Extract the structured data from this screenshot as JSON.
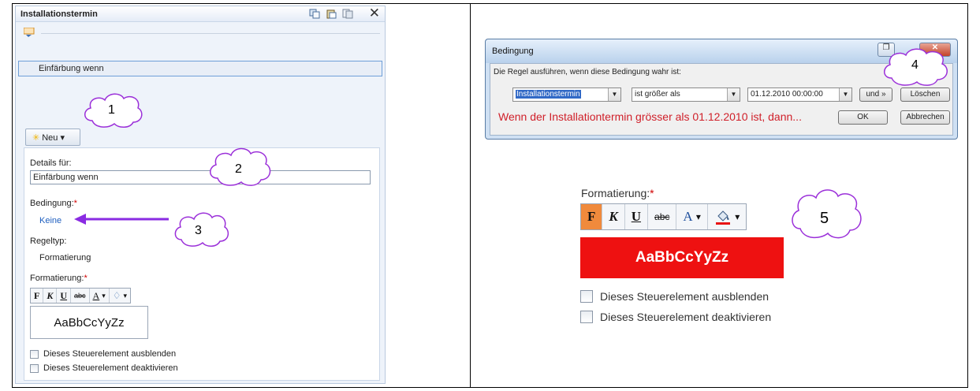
{
  "left_panel": {
    "title": "Installationstermin",
    "rule_item": "Einfärbung wenn",
    "new_button": "Neu",
    "details_label": "Details für:",
    "details_value": "Einfärbung wenn",
    "condition_label": "Bedingung:",
    "required_mark": "*",
    "condition_link": "Keine",
    "ruletype_label": "Regeltyp:",
    "ruletype_value": "Formatierung",
    "format_label": "Formatierung:",
    "toolbar": {
      "bold": "F",
      "italic": "K",
      "underline": "U",
      "strike": "abc",
      "font_color": "A"
    },
    "preview_text": "AaBbCcYyZz",
    "checkbox_hide": "Dieses Steuerelement ausblenden",
    "checkbox_disable": "Dieses Steuerelement deaktivieren"
  },
  "callouts": [
    "1",
    "2",
    "3",
    "4",
    "5"
  ],
  "dialog": {
    "title": "Bedingung",
    "prompt": "Die Regel ausführen, wenn diese Bedingung wahr ist:",
    "field_select": "Installationstermin",
    "operator_select": "ist größer als",
    "value_input": "01.12.2010 00:00:00",
    "and_button": "und »",
    "delete_button": "Löschen",
    "condition_text": "Wenn der Installationtermin grösser als 01.12.2010 ist, dann...",
    "ok_button": "OK",
    "cancel_button": "Abbrechen"
  },
  "zoomed_format": {
    "label": "Formatierung:",
    "required_mark": "*",
    "toolbar": {
      "bold": "F",
      "italic": "K",
      "underline": "U",
      "strike": "abc",
      "font_color": "A"
    },
    "preview_text": "AaBbCcYyZz",
    "checkbox_hide": "Dieses Steuerelement ausblenden",
    "checkbox_disable": "Dieses Steuerelement deaktivieren"
  },
  "colors": {
    "highlight_red": "#ee1111",
    "active_orange": "#f08a3c",
    "arrow_purple": "#8a2be2",
    "cloud_purple": "#9b30d9",
    "link_blue": "#1f5fbf"
  }
}
